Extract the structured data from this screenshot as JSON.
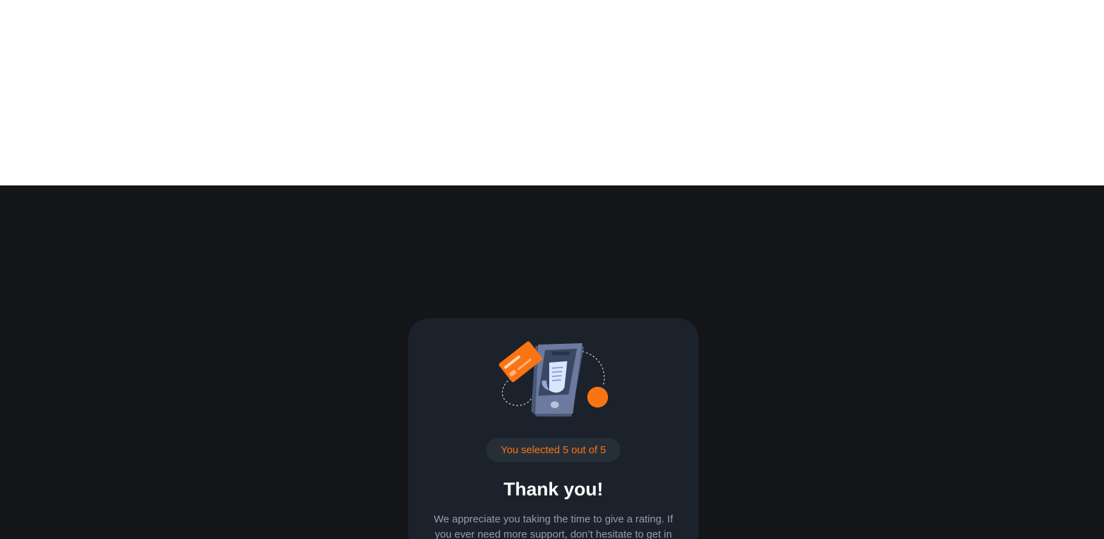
{
  "thank_you": {
    "illustration_icon": "payment-phone-illustration",
    "selection_text": "You selected 5 out of 5",
    "title": "Thank you!",
    "message": "We appreciate you taking the time to give a rating. If you ever need more support, don’t hesitate to get in touch!"
  },
  "colors": {
    "page_background": "#131518",
    "card_background": "#1b222c",
    "accent": "#fb7413",
    "badge_background": "#262f38",
    "title_text": "#ffffff",
    "body_text": "#959eac"
  }
}
